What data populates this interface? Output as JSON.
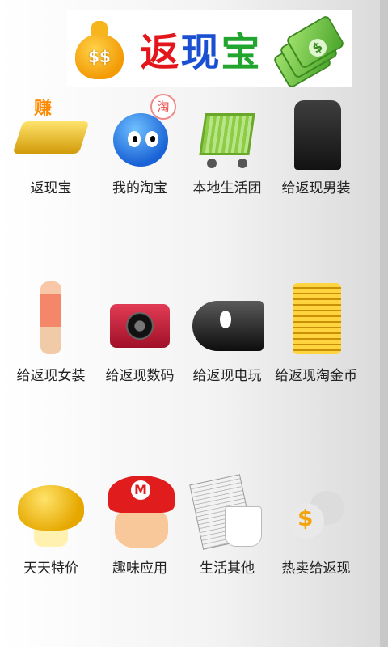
{
  "banner": {
    "title_part1": "返",
    "title_part2": "现",
    "title_part3": "宝",
    "bag_symbol": "$$",
    "cash_symbol": "$"
  },
  "badges": {
    "earn": "赚",
    "taobao": "淘",
    "mario_letter": "M",
    "money_sign": "$"
  },
  "items": [
    {
      "label": "返现宝",
      "icon": "gold-bar-icon"
    },
    {
      "label": "我的淘宝",
      "icon": "taobao-mascot-icon"
    },
    {
      "label": "本地生活团",
      "icon": "shopping-cart-icon"
    },
    {
      "label": "给返现男装",
      "icon": "men-coat-icon"
    },
    {
      "label": "给返现女装",
      "icon": "women-fashion-icon"
    },
    {
      "label": "给返现数码",
      "icon": "camera-icon"
    },
    {
      "label": "给返现电玩",
      "icon": "bullet-bill-icon"
    },
    {
      "label": "给返现淘金币",
      "icon": "gold-coins-icon"
    },
    {
      "label": "天天特价",
      "icon": "golden-mushroom-icon"
    },
    {
      "label": "趣味应用",
      "icon": "mario-icon"
    },
    {
      "label": "生活其他",
      "icon": "newspaper-coffee-icon"
    },
    {
      "label": "热卖给返现",
      "icon": "money-bags-icon"
    }
  ],
  "colors": {
    "title_red": "#e3161c",
    "title_blue": "#1b4fd1",
    "title_green": "#21a52f"
  }
}
